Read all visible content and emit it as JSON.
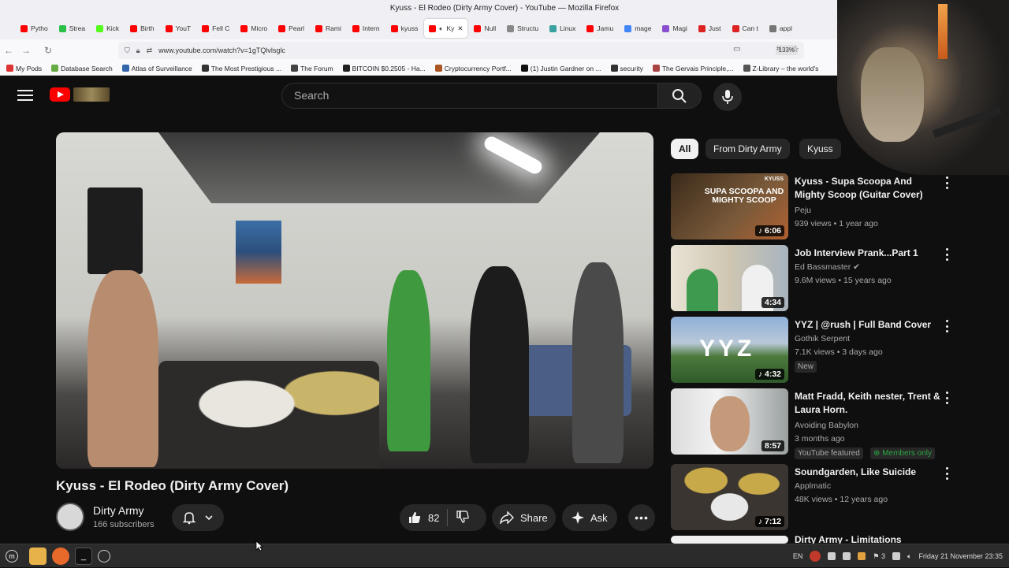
{
  "window": {
    "title": "Kyuss - El Rodeo (Dirty Army Cover) - YouTube — Mozilla Firefox"
  },
  "tabs": [
    {
      "label": "Pytho",
      "color": "#ff0000"
    },
    {
      "label": "Strea",
      "color": "#2bbf4a"
    },
    {
      "label": "Kick",
      "color": "#53fc18"
    },
    {
      "label": "Birth",
      "color": "#ff0000"
    },
    {
      "label": "YouT",
      "color": "#ff0000"
    },
    {
      "label": "Fell C",
      "color": "#ff0000"
    },
    {
      "label": "Micro",
      "color": "#ff0000"
    },
    {
      "label": "Pearl",
      "color": "#ff0000"
    },
    {
      "label": "Rami",
      "color": "#ff0000"
    },
    {
      "label": "Intern",
      "color": "#ff0000"
    },
    {
      "label": "kyuss",
      "color": "#ff0000"
    },
    {
      "label": "Ky",
      "color": "#ff0000",
      "active": true
    },
    {
      "label": "Null",
      "color": "#ff0000"
    },
    {
      "label": "Structu",
      "color": "#888888"
    },
    {
      "label": "Linux",
      "color": "#3aa0a0"
    },
    {
      "label": "Jamu",
      "color": "#ff0000"
    },
    {
      "label": "mage",
      "color": "#4285f4"
    },
    {
      "label": "Magi",
      "color": "#8a4fd0"
    },
    {
      "label": "Just",
      "color": "#d22"
    },
    {
      "label": "Can t",
      "color": "#d22"
    },
    {
      "label": "appl",
      "color": "#777"
    }
  ],
  "navbar": {
    "url": "www.youtube.com/watch?v=1gTQlvlsglc",
    "zoom": "133%"
  },
  "bookmarks": [
    "My Pods",
    "Database Search",
    "Atlas of Surveillance",
    "The Most Prestigious ...",
    "The Forum",
    "BITCOIN $0.2505 - Ha...",
    "Cryptocurrency Portf...",
    "(1) Justin Gardner on ...",
    "security",
    "The Gervais Principle,...",
    "Z-Library – the world's"
  ],
  "youtube": {
    "search_placeholder": "Search",
    "video": {
      "title": "Kyuss - El Rodeo (Dirty Army Cover)",
      "channel": "Dirty Army",
      "subscribers": "166 subscribers",
      "likes": "82",
      "share": "Share",
      "ask": "Ask"
    },
    "chips": [
      "All",
      "From Dirty Army",
      "Kyuss"
    ],
    "recommendations": [
      {
        "title": "Kyuss - Supa Scoopa And Mighty Scoop (Guitar Cover)",
        "channel": "Peju",
        "meta": "939 views • 1 year ago",
        "duration": "6:06",
        "thumb_text": "SUPA SCOOPA AND MIGHTY SCOOP",
        "thumb_tag": "KYUSS"
      },
      {
        "title": "Job Interview Prank...Part 1",
        "channel": "Ed Bassmaster",
        "meta": "9.6M views • 15 years ago",
        "duration": "4:34"
      },
      {
        "title": "YYZ | @rush | Full Band Cover",
        "channel": "Gothik Serpent",
        "meta": "7.1K views • 3 days ago",
        "duration": "4:32",
        "badge": "New",
        "thumb_text": "YYZ"
      },
      {
        "title": "Matt Fradd, Keith nester, Trent & Laura Horn.",
        "channel": "Avoiding Babylon",
        "meta": "3 months ago",
        "duration": "8:57",
        "badge": "YouTube featured",
        "badge2": "Members only"
      },
      {
        "title": "Soundgarden, Like Suicide",
        "channel": "Applmatic",
        "meta": "48K views • 12 years ago",
        "duration": "7:12"
      },
      {
        "title": "Dirty Army - Limitations",
        "channel": "",
        "meta": "",
        "duration": ""
      }
    ]
  },
  "taskbar": {
    "lang": "EN",
    "workspace": "3",
    "clock": "Friday 21 November 23:35"
  }
}
